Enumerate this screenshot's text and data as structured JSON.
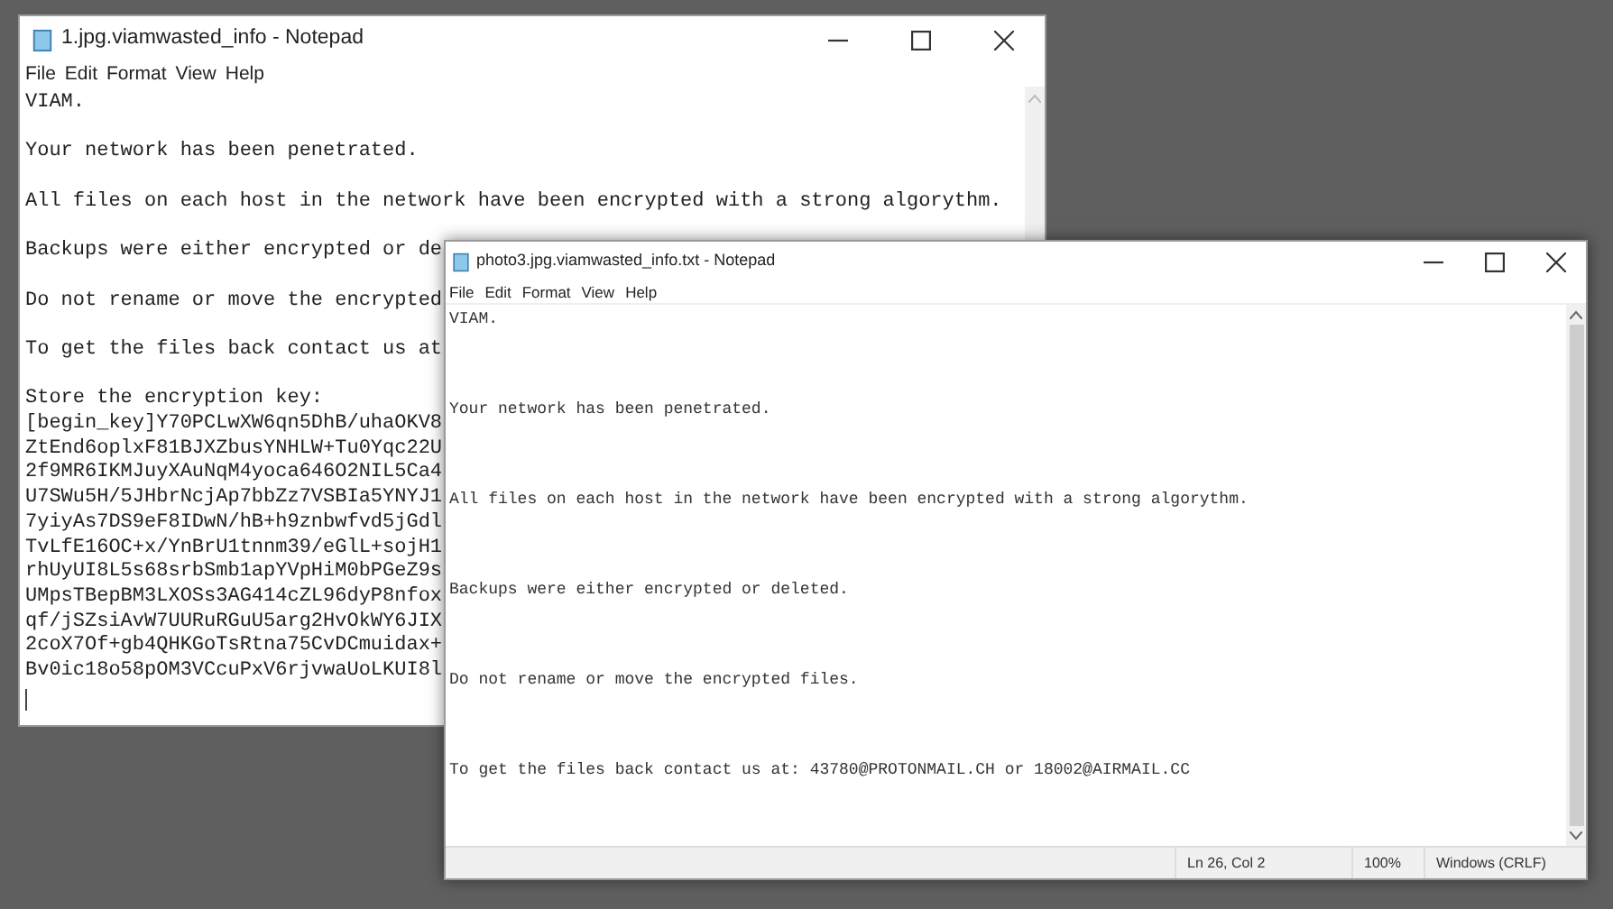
{
  "windows": [
    {
      "title": "1.jpg.viamwasted_info - Notepad",
      "menu": [
        "File",
        "Edit",
        "Format",
        "View",
        "Help"
      ],
      "paragraphs": [
        [
          "VIAM."
        ],
        [
          "Your network has been penetrated."
        ],
        [
          "All files on each host in the network have been encrypted with a strong algorythm."
        ],
        [
          "Backups were either encrypted or de"
        ],
        [
          "Do not rename or move the encrypted"
        ],
        [
          "To get the files back contact us at"
        ],
        [
          "Store the encryption key:",
          "[begin_key]Y70PCLwXW6qn5DhB/uhaOKV8",
          "ZtEnd6oplxF81BJXZbusYNHLW+Tu0Yqc22U",
          "2f9MR6IKMJuyXAuNqM4yoca646O2NIL5Ca4",
          "U7SWu5H/5JHbrNcjAp7bbZz7VSBIa5YNYJ1",
          "7yiyAs7DS9eF8IDwN/hB+h9znbwfvd5jGdl",
          "TvLfE16OC+x/YnBrU1tnnm39/eGlL+sojH1",
          "rhUyUI8L5s68srbSmb1apYVpHiM0bPGeZ9s",
          "UMpsTBepBM3LXOSs3AG414cZL96dyP8nfox",
          "qf/jSZsiAvW7UURuRGuU5arg2HvOkWY6JIX",
          "2coX7Of+gb4QHKGoTsRtna75CvDCmuidax+",
          "Bv0ic18o58pOM3VCcuPxV6rjvwaUoLKUI8l"
        ]
      ]
    },
    {
      "title": "photo3.jpg.viamwasted_info.txt - Notepad",
      "menu": [
        "File",
        "Edit",
        "Format",
        "View",
        "Help"
      ],
      "paragraphs": [
        [
          "VIAM."
        ],
        [
          "Your network has been penetrated."
        ],
        [
          "All files on each host in the network have been encrypted with a strong algorythm."
        ],
        [
          "Backups were either encrypted or deleted."
        ],
        [
          "Do not rename or move the encrypted files."
        ],
        [
          "To get the files back contact us at: 43780@PROTONMAIL.CH or 18002@AIRMAIL.CC"
        ]
      ],
      "status_bar": [
        "Ln 26, Col 2",
        "100%",
        "Windows (CRLF)"
      ]
    }
  ]
}
